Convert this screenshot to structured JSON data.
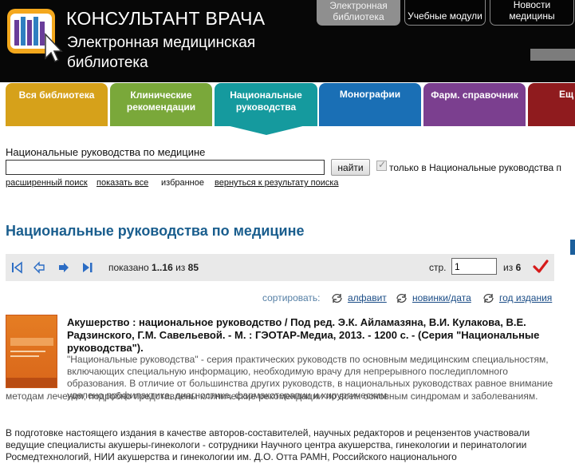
{
  "brand": {
    "title": "КОНСУЛЬТАНТ ВРАЧА",
    "subtitle": "Электронная медицинская библиотека"
  },
  "top_nav": [
    {
      "label": "Электронная библиотека",
      "active": true
    },
    {
      "label": "Учебные модули",
      "active": false
    },
    {
      "label": "Новости медицины",
      "active": false
    }
  ],
  "tabs": [
    {
      "label": "Вся библиотека",
      "color": "#d6a11a"
    },
    {
      "label": "Клинические рекомендации",
      "color": "#7aa83a"
    },
    {
      "label": "Национальные руководства",
      "color": "#159a9e",
      "active": true
    },
    {
      "label": "Монографии",
      "color": "#1a6fb5"
    },
    {
      "label": "Фарм. справочник",
      "color": "#7b3f8f"
    },
    {
      "label": "Ещ",
      "color": "#8f1b1e"
    }
  ],
  "search": {
    "label": "Национальные руководства по медицине",
    "value": "",
    "button": "найти",
    "only_label": "только в Национальные руководства п",
    "links": {
      "advanced": "расширенный поиск",
      "show_all": "показать все",
      "favorites": "избранное",
      "back": "вернуться к результату поиска"
    }
  },
  "page_title": "Национальные руководства по медицине",
  "pager": {
    "shown_prefix": "показано",
    "range": "1..16",
    "of_word": "из",
    "total": "85",
    "page_label": "стр.",
    "page_value": "1",
    "pages_of": "из",
    "pages_total": "6"
  },
  "sort": {
    "label": "сортировать:",
    "options": [
      "алфавит",
      "новинки/дата",
      "год издания"
    ]
  },
  "result": {
    "title": "Акушерство : национальное руководство / Под ред. Э.К. Айламазяна, В.И. Кулакова, В.Е. Радзинского, Г.М. Савельевой. - М. : ГЭОТАР-Медиа, 2013. - 1200 с. - (Серия \"Национальные руководства\").",
    "desc1": "\"Национальные руководства\" - серия практических руководств по основным медицинским специальностям, включающих специальную информацию, необходимую врачу для непрерывного последипломного образования. В отличие от большинства других руководств, в национальных руководствах равное внимание уделено профилактике, диагностике, фармакотерапии и хирургическим",
    "desc2": "методам лечения, подробно представлены клинические рекомендации по всем основным синдромам и заболеваниям.",
    "desc3": "В подготовке настоящего издания в качестве авторов-составителей, научных редакторов и рецензентов участвовали ведущие специалисты акушеры-гинекологи - сотрудники Научного центра акушерства, гинекологии и перинатологии Росмедтехнологий, НИИ акушерства и гинекологии им. Д.О. Отта РАМН, Российского национального"
  }
}
